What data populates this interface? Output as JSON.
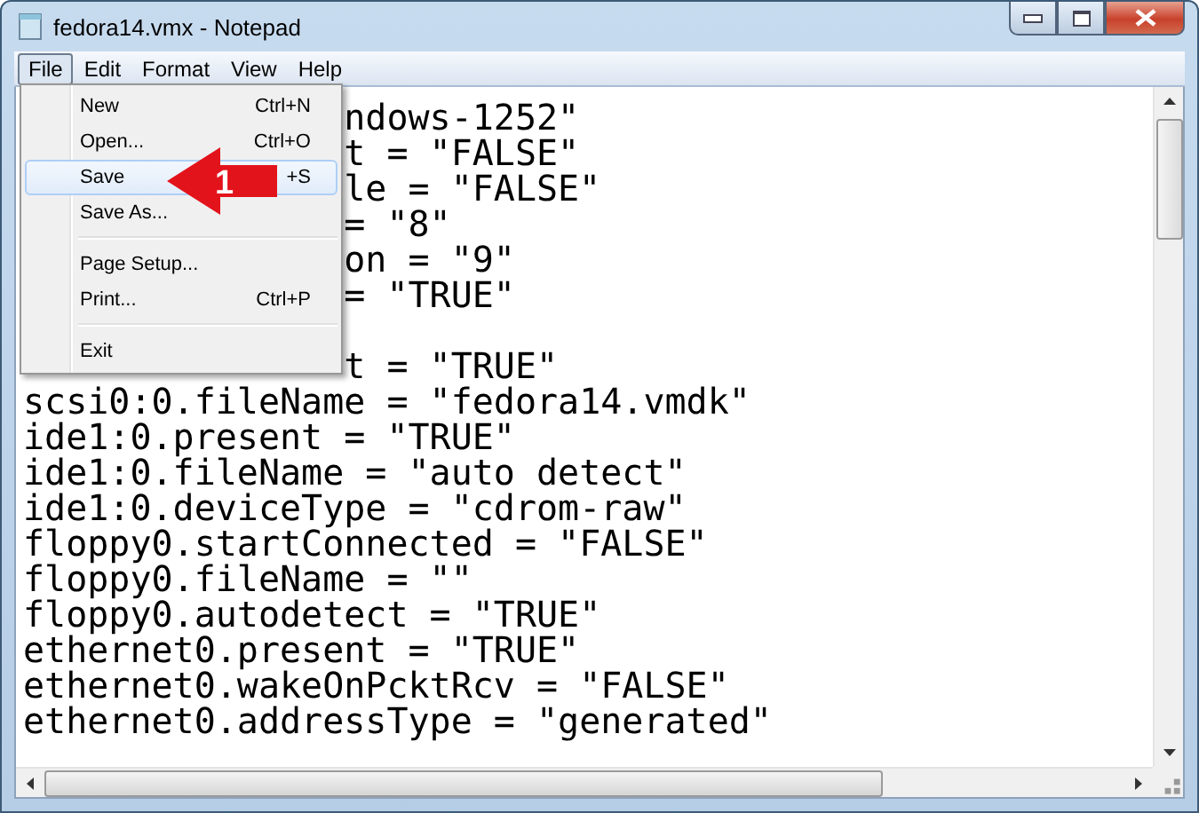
{
  "window": {
    "title": "fedora14.vmx - Notepad"
  },
  "menubar": [
    {
      "label": "File",
      "selected": true
    },
    {
      "label": "Edit",
      "selected": false
    },
    {
      "label": "Format",
      "selected": false
    },
    {
      "label": "View",
      "selected": false
    },
    {
      "label": "Help",
      "selected": false
    }
  ],
  "file_menu": [
    {
      "kind": "item",
      "label": "New",
      "shortcut": "Ctrl+N",
      "selected": false
    },
    {
      "kind": "item",
      "label": "Open...",
      "shortcut": "Ctrl+O",
      "selected": false
    },
    {
      "kind": "item",
      "label": "Save",
      "shortcut": "+S",
      "selected": true
    },
    {
      "kind": "item",
      "label": "Save As...",
      "selected": false
    },
    {
      "kind": "separator"
    },
    {
      "kind": "item",
      "label": "Page Setup...",
      "selected": false
    },
    {
      "kind": "item",
      "label": "Print...",
      "shortcut": "Ctrl+P",
      "selected": false
    },
    {
      "kind": "separator"
    },
    {
      "kind": "item",
      "label": "Exit",
      "selected": false
    }
  ],
  "callout": {
    "label": "1"
  },
  "editor_lines": [
    {
      "kind": "partial",
      "text": "ndows-1252\""
    },
    {
      "kind": "partial",
      "text": "t = \"FALSE\""
    },
    {
      "kind": "partial",
      "text": "le = \"FALSE\""
    },
    {
      "kind": "partial",
      "text": "= \"8\""
    },
    {
      "kind": "partial",
      "text": "on = \"9\""
    },
    {
      "kind": "partial",
      "text": "= \"TRUE\""
    },
    {
      "kind": "blank"
    },
    {
      "kind": "partial",
      "text": "t = \"TRUE\""
    },
    {
      "kind": "full",
      "text": "scsi0:0.fileName = \"fedora14.vmdk\""
    },
    {
      "kind": "full",
      "text": "ide1:0.present = \"TRUE\""
    },
    {
      "kind": "full",
      "text": "ide1:0.fileName = \"auto detect\""
    },
    {
      "kind": "full",
      "text": "ide1:0.deviceType = \"cdrom-raw\""
    },
    {
      "kind": "full",
      "text": "floppy0.startConnected = \"FALSE\""
    },
    {
      "kind": "full",
      "text": "floppy0.fileName = \"\""
    },
    {
      "kind": "full",
      "text": "floppy0.autodetect = \"TRUE\""
    },
    {
      "kind": "full",
      "text": "ethernet0.present = \"TRUE\""
    },
    {
      "kind": "full",
      "text": "ethernet0.wakeOnPcktRcv = \"FALSE\""
    },
    {
      "kind": "full",
      "text": "ethernet0.addressType = \"generated\""
    }
  ]
}
